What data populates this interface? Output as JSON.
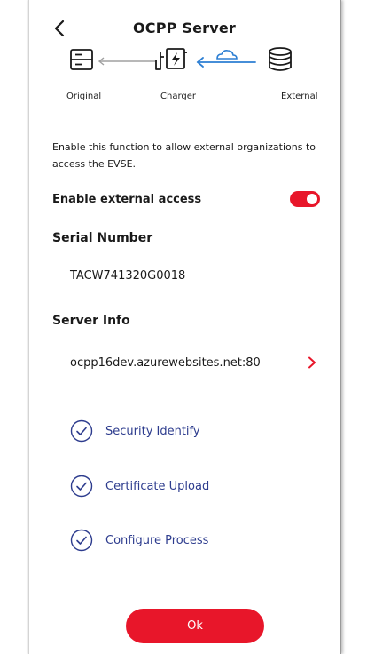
{
  "header": {
    "title": "OCPP Server",
    "back_icon": "chevron-left-icon"
  },
  "diagram": {
    "labels": {
      "original": "Original",
      "charger": "Charger",
      "external": "External"
    },
    "icons": [
      "server-icon",
      "charger-icon",
      "cloud-icon",
      "database-icon"
    ],
    "active_color": "#2d7fd3"
  },
  "description": "Enable this function to allow external organizations to access the EVSE.",
  "external_access": {
    "label": "Enable external access",
    "enabled": true
  },
  "serial": {
    "title": "Serial Number",
    "value": "TACW741320G0018"
  },
  "server_info": {
    "title": "Server Info",
    "value": "ocpp16dev.azurewebsites.net:80"
  },
  "steps": [
    {
      "label": "Security Identify",
      "status": "complete"
    },
    {
      "label": "Certificate Upload",
      "status": "complete"
    },
    {
      "label": "Configure Process",
      "status": "complete"
    }
  ],
  "ok_button": {
    "label": "Ok"
  },
  "colors": {
    "accent_red": "#e8162a",
    "step_blue": "#2d3c8e"
  }
}
